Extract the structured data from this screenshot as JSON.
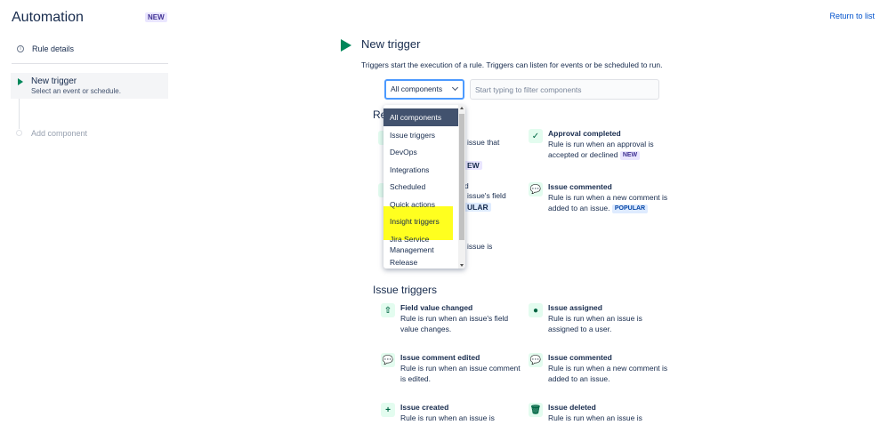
{
  "header": {
    "title": "Automation",
    "badge": "NEW",
    "return_link": "Return to list"
  },
  "sidebar": {
    "rule_details": "Rule details",
    "active_step": {
      "title": "New trigger",
      "subtitle": "Select an event or schedule."
    },
    "add_component": "Add component"
  },
  "main": {
    "title": "New trigger",
    "description": "Triggers start the execution of a rule. Triggers can listen for events or be scheduled to run.",
    "select": {
      "value": "All components"
    },
    "filter": {
      "placeholder": "Start typing to filter components"
    }
  },
  "dropdown": {
    "options": [
      "All components",
      "Issue triggers",
      "DevOps",
      "Integrations",
      "Scheduled",
      "Quick actions",
      "Insight triggers",
      "Jira Service Management",
      "Release"
    ],
    "selected": "All components",
    "highlight_color": "#ffff1f"
  },
  "recommended": {
    "title_partial": "Re",
    "fragments": {
      "f1": "issue that",
      "f2": "EW",
      "f3": "d",
      "f4": "issue's field",
      "f5": "ULAR",
      "f6": "issue is"
    },
    "cards": [
      {
        "title": "Approval completed",
        "desc": "Rule is run when an approval is accepted or declined",
        "badge": "NEW",
        "icon": "check-circle-icon"
      },
      {
        "title": "Issue commented",
        "desc": "Rule is run when a new comment is added to an issue.",
        "badge": "POPULAR",
        "icon": "comment-icon"
      }
    ]
  },
  "issue_triggers": {
    "title": "Issue triggers",
    "cards": [
      {
        "title": "Field value changed",
        "desc": "Rule is run when an issue's field value changes.",
        "icon": "field-change-icon"
      },
      {
        "title": "Issue assigned",
        "desc": "Rule is run when an issue is assigned to a user.",
        "icon": "user-icon"
      },
      {
        "title": "Issue comment edited",
        "desc": "Rule is run when an issue comment is edited.",
        "icon": "comment-icon"
      },
      {
        "title": "Issue commented",
        "desc": "Rule is run when a new comment is added to an issue.",
        "icon": "comment-icon"
      },
      {
        "title": "Issue created",
        "desc": "Rule is run when an issue is",
        "icon": "plus-icon"
      },
      {
        "title": "Issue deleted",
        "desc": "Rule is run when an issue is",
        "icon": "trash-icon"
      }
    ]
  },
  "colors": {
    "accent": "#00875a",
    "link": "#0052cc",
    "focus": "#4c9aff"
  }
}
